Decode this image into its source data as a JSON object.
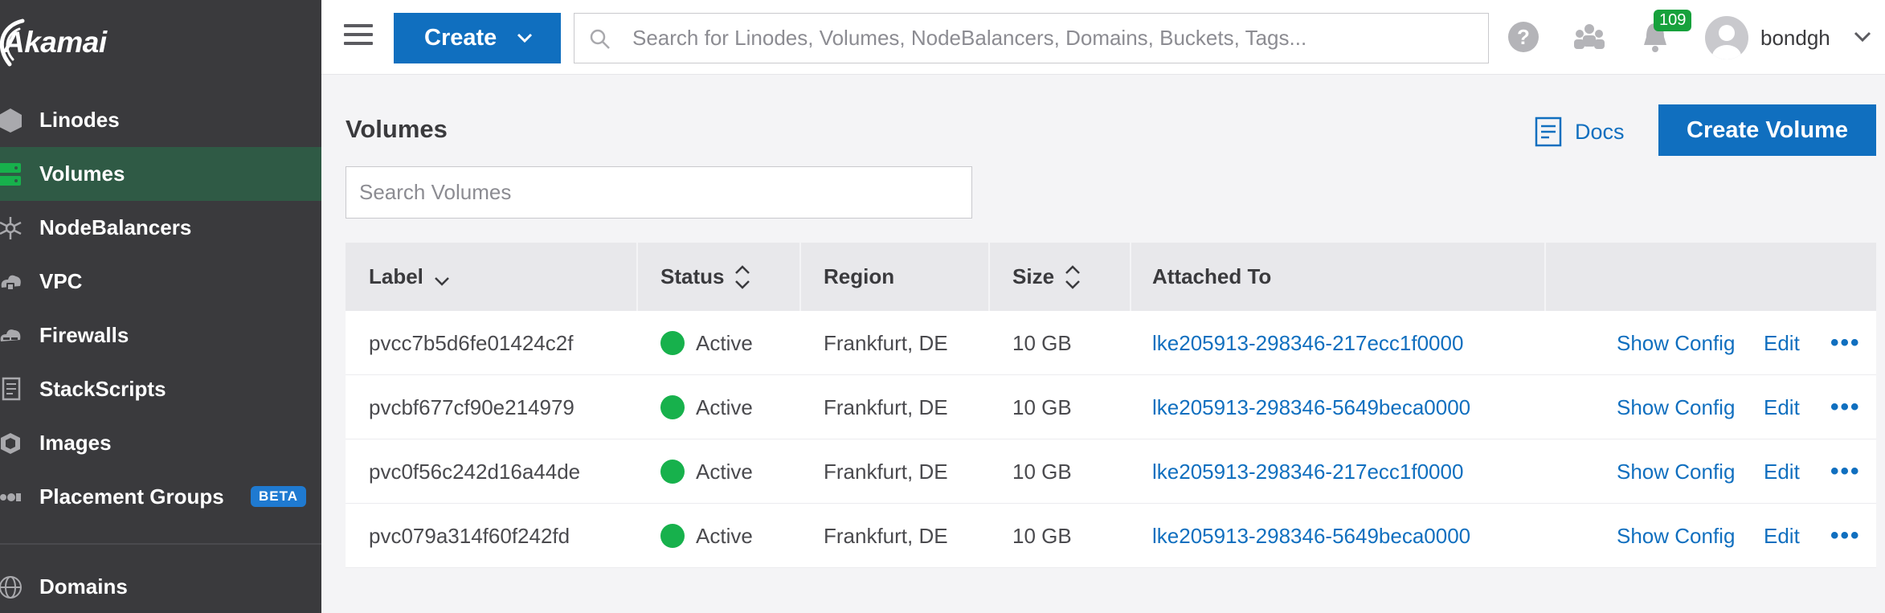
{
  "brand": {
    "name": "Akamai"
  },
  "sidebar": {
    "items": [
      {
        "label": "Linodes",
        "icon": "hexagon-icon"
      },
      {
        "label": "Volumes",
        "icon": "volumes-icon",
        "active": true
      },
      {
        "label": "NodeBalancers",
        "icon": "nodebalancer-icon"
      },
      {
        "label": "VPC",
        "icon": "vpc-icon"
      },
      {
        "label": "Firewalls",
        "icon": "firewall-icon"
      },
      {
        "label": "StackScripts",
        "icon": "stackscript-icon"
      },
      {
        "label": "Images",
        "icon": "images-icon"
      },
      {
        "label": "Placement Groups",
        "icon": "placement-groups-icon",
        "badge": "BETA"
      },
      {
        "label": "Domains",
        "icon": "globe-icon"
      }
    ]
  },
  "topbar": {
    "create_label": "Create",
    "search_placeholder": "Search for Linodes, Volumes, NodeBalancers, Domains, Buckets, Tags...",
    "notification_count": "109",
    "username": "bondgh"
  },
  "page": {
    "title": "Volumes",
    "docs_label": "Docs",
    "create_button": "Create Volume",
    "search_placeholder": "Search Volumes"
  },
  "table": {
    "headers": {
      "label": "Label",
      "status": "Status",
      "region": "Region",
      "size": "Size",
      "attached": "Attached To"
    },
    "actions": {
      "show_config": "Show Config",
      "edit": "Edit",
      "more": "•••"
    },
    "rows": [
      {
        "label": "pvcc7b5d6fe01424c2f",
        "status": "Active",
        "region": "Frankfurt, DE",
        "size": "10 GB",
        "attached": "lke205913-298346-217ecc1f0000"
      },
      {
        "label": "pvcbf677cf90e214979",
        "status": "Active",
        "region": "Frankfurt, DE",
        "size": "10 GB",
        "attached": "lke205913-298346-5649beca0000"
      },
      {
        "label": "pvc0f56c242d16a44de",
        "status": "Active",
        "region": "Frankfurt, DE",
        "size": "10 GB",
        "attached": "lke205913-298346-217ecc1f0000"
      },
      {
        "label": "pvc079a314f60f242fd",
        "status": "Active",
        "region": "Frankfurt, DE",
        "size": "10 GB",
        "attached": "lke205913-298346-5649beca0000"
      }
    ]
  },
  "colors": {
    "accent": "#106fbf",
    "sidebar": "#3a3a3d",
    "active_nav": "#2f5a45",
    "status_active": "#17b14c",
    "badge": "#17a13c"
  }
}
